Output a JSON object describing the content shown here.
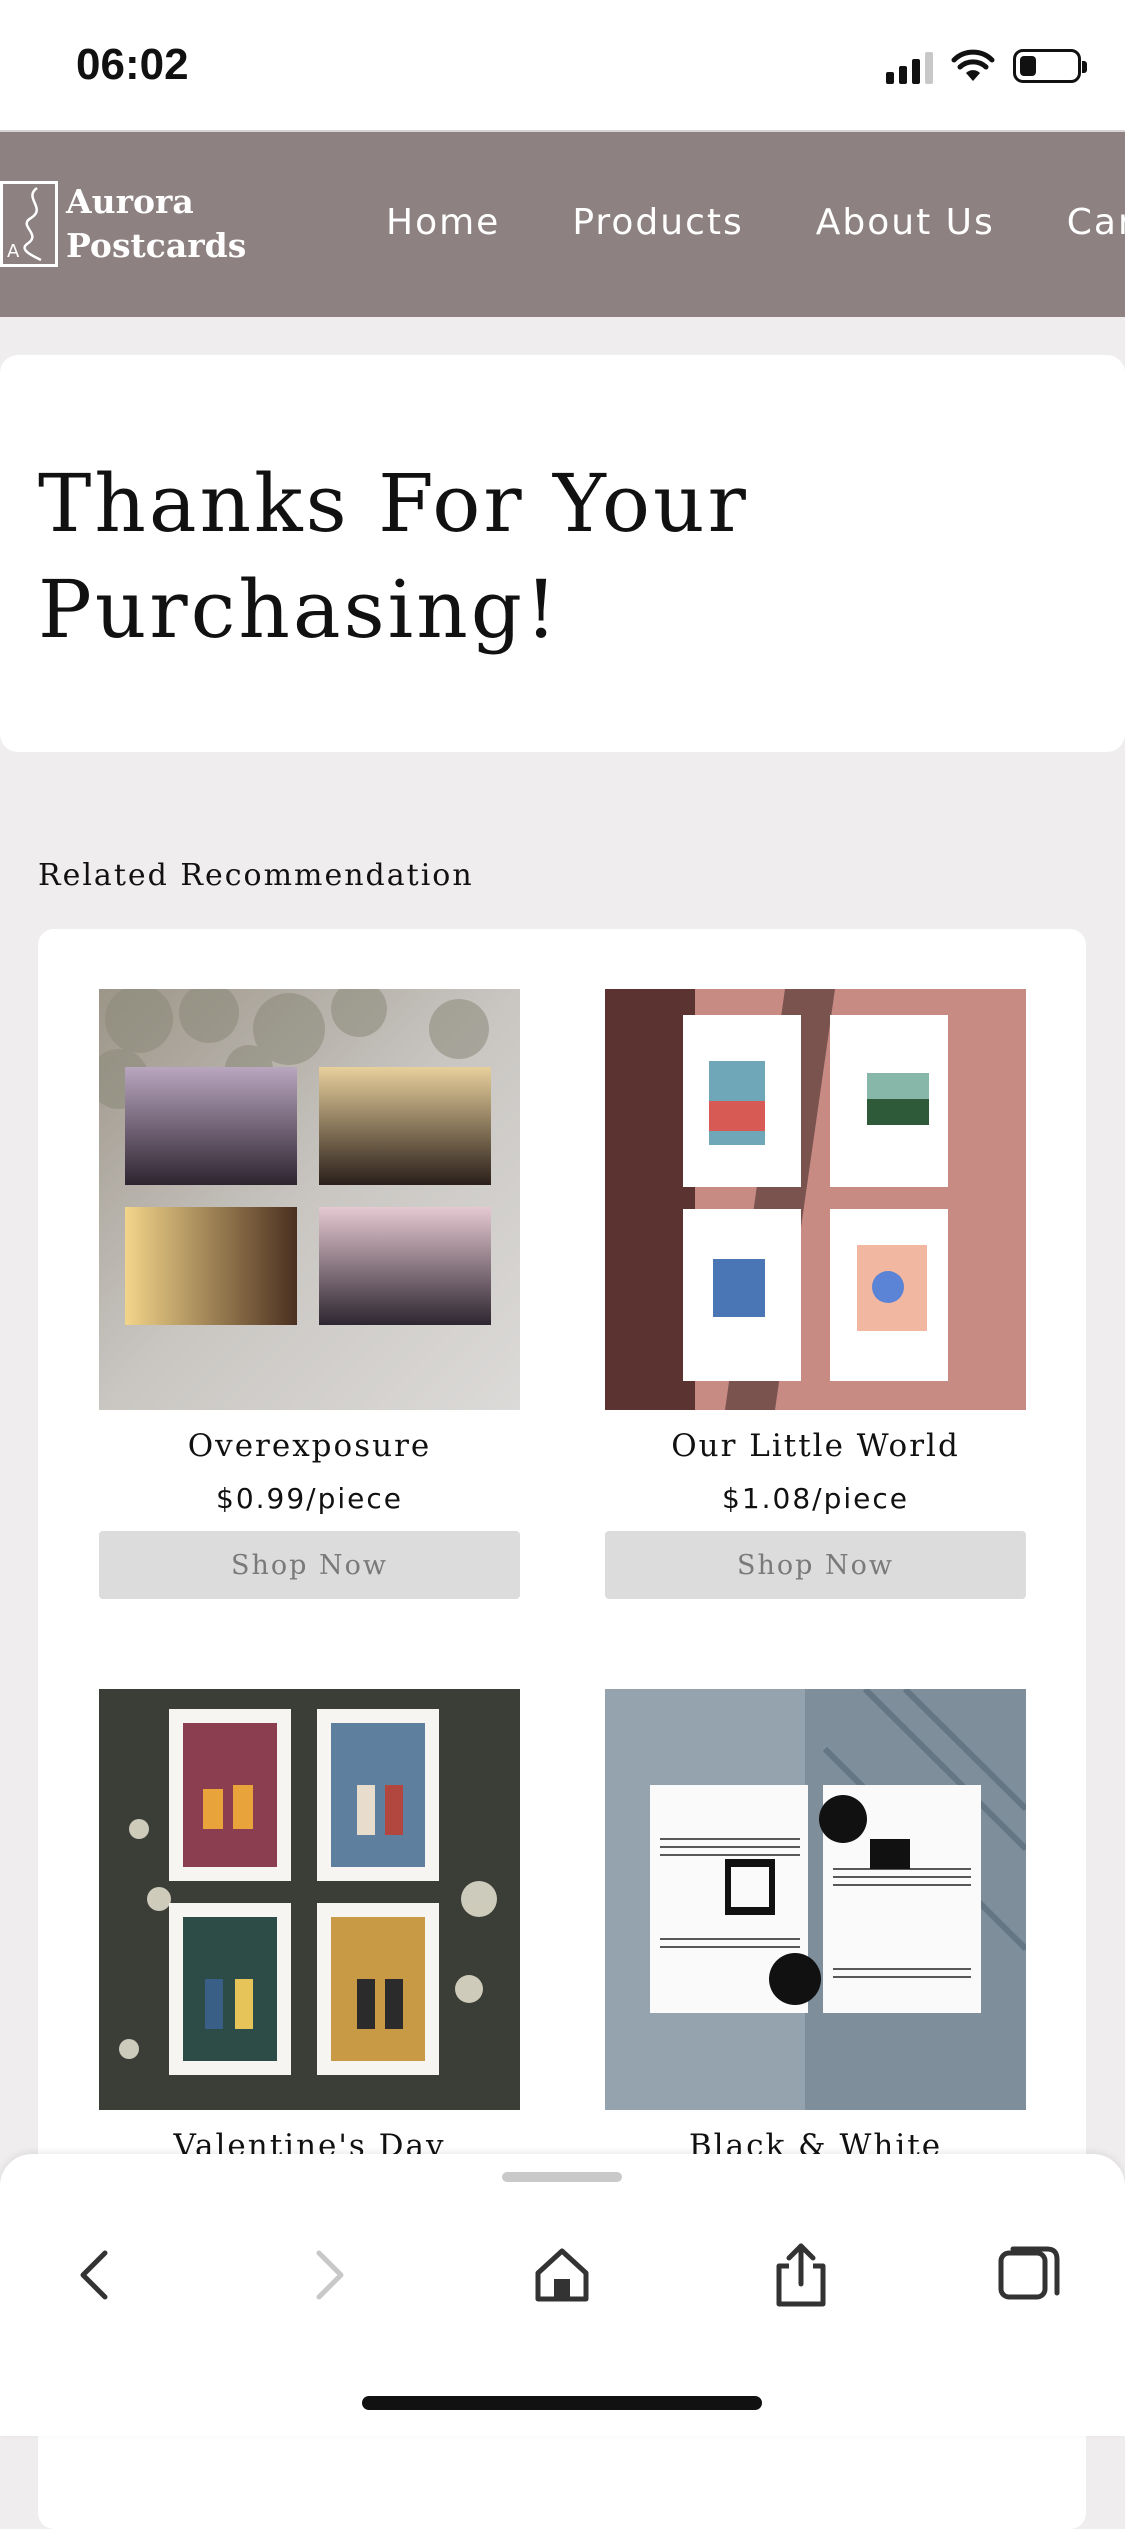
{
  "status_bar": {
    "time": "06:02",
    "battery_level": 0.3
  },
  "nav": {
    "logo_line1": "Aurora",
    "logo_line2": "Postcards",
    "logo_mark_letter": "A",
    "links": [
      "Home",
      "Products",
      "About Us",
      "Car"
    ]
  },
  "thanks": {
    "title": "Thanks For Your Purchasing!"
  },
  "related": {
    "heading": "Related Recommendation",
    "products": [
      {
        "name": "Overexposure",
        "price": "$0.99/piece",
        "button": "Shop Now"
      },
      {
        "name": "Our Little World",
        "price": "$1.08/piece",
        "button": "Shop Now"
      },
      {
        "name": "Valentine's Day"
      },
      {
        "name": "Black & White"
      }
    ]
  },
  "icons": [
    "back-icon",
    "forward-icon",
    "home-icon",
    "share-icon",
    "tabs-icon"
  ],
  "colors": {
    "nav_bg": "#8d8182",
    "page_bg": "#efedee",
    "button_bg": "#dcdcdc"
  }
}
